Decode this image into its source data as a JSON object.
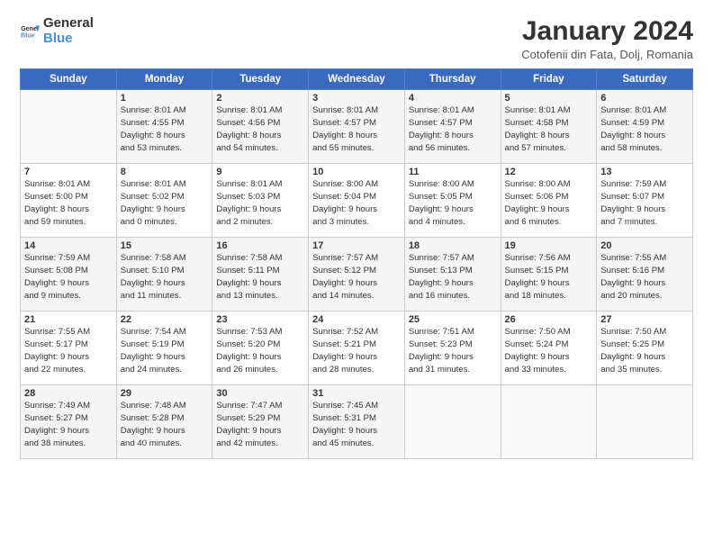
{
  "header": {
    "logo_general": "General",
    "logo_blue": "Blue",
    "title": "January 2024",
    "location": "Cotofenii din Fata, Dolj, Romania"
  },
  "days_of_week": [
    "Sunday",
    "Monday",
    "Tuesday",
    "Wednesday",
    "Thursday",
    "Friday",
    "Saturday"
  ],
  "weeks": [
    [
      {
        "day": "",
        "info": ""
      },
      {
        "day": "1",
        "info": "Sunrise: 8:01 AM\nSunset: 4:55 PM\nDaylight: 8 hours\nand 53 minutes."
      },
      {
        "day": "2",
        "info": "Sunrise: 8:01 AM\nSunset: 4:56 PM\nDaylight: 8 hours\nand 54 minutes."
      },
      {
        "day": "3",
        "info": "Sunrise: 8:01 AM\nSunset: 4:57 PM\nDaylight: 8 hours\nand 55 minutes."
      },
      {
        "day": "4",
        "info": "Sunrise: 8:01 AM\nSunset: 4:57 PM\nDaylight: 8 hours\nand 56 minutes."
      },
      {
        "day": "5",
        "info": "Sunrise: 8:01 AM\nSunset: 4:58 PM\nDaylight: 8 hours\nand 57 minutes."
      },
      {
        "day": "6",
        "info": "Sunrise: 8:01 AM\nSunset: 4:59 PM\nDaylight: 8 hours\nand 58 minutes."
      }
    ],
    [
      {
        "day": "7",
        "info": "Sunrise: 8:01 AM\nSunset: 5:00 PM\nDaylight: 8 hours\nand 59 minutes."
      },
      {
        "day": "8",
        "info": "Sunrise: 8:01 AM\nSunset: 5:02 PM\nDaylight: 9 hours\nand 0 minutes."
      },
      {
        "day": "9",
        "info": "Sunrise: 8:01 AM\nSunset: 5:03 PM\nDaylight: 9 hours\nand 2 minutes."
      },
      {
        "day": "10",
        "info": "Sunrise: 8:00 AM\nSunset: 5:04 PM\nDaylight: 9 hours\nand 3 minutes."
      },
      {
        "day": "11",
        "info": "Sunrise: 8:00 AM\nSunset: 5:05 PM\nDaylight: 9 hours\nand 4 minutes."
      },
      {
        "day": "12",
        "info": "Sunrise: 8:00 AM\nSunset: 5:06 PM\nDaylight: 9 hours\nand 6 minutes."
      },
      {
        "day": "13",
        "info": "Sunrise: 7:59 AM\nSunset: 5:07 PM\nDaylight: 9 hours\nand 7 minutes."
      }
    ],
    [
      {
        "day": "14",
        "info": "Sunrise: 7:59 AM\nSunset: 5:08 PM\nDaylight: 9 hours\nand 9 minutes."
      },
      {
        "day": "15",
        "info": "Sunrise: 7:58 AM\nSunset: 5:10 PM\nDaylight: 9 hours\nand 11 minutes."
      },
      {
        "day": "16",
        "info": "Sunrise: 7:58 AM\nSunset: 5:11 PM\nDaylight: 9 hours\nand 13 minutes."
      },
      {
        "day": "17",
        "info": "Sunrise: 7:57 AM\nSunset: 5:12 PM\nDaylight: 9 hours\nand 14 minutes."
      },
      {
        "day": "18",
        "info": "Sunrise: 7:57 AM\nSunset: 5:13 PM\nDaylight: 9 hours\nand 16 minutes."
      },
      {
        "day": "19",
        "info": "Sunrise: 7:56 AM\nSunset: 5:15 PM\nDaylight: 9 hours\nand 18 minutes."
      },
      {
        "day": "20",
        "info": "Sunrise: 7:55 AM\nSunset: 5:16 PM\nDaylight: 9 hours\nand 20 minutes."
      }
    ],
    [
      {
        "day": "21",
        "info": "Sunrise: 7:55 AM\nSunset: 5:17 PM\nDaylight: 9 hours\nand 22 minutes."
      },
      {
        "day": "22",
        "info": "Sunrise: 7:54 AM\nSunset: 5:19 PM\nDaylight: 9 hours\nand 24 minutes."
      },
      {
        "day": "23",
        "info": "Sunrise: 7:53 AM\nSunset: 5:20 PM\nDaylight: 9 hours\nand 26 minutes."
      },
      {
        "day": "24",
        "info": "Sunrise: 7:52 AM\nSunset: 5:21 PM\nDaylight: 9 hours\nand 28 minutes."
      },
      {
        "day": "25",
        "info": "Sunrise: 7:51 AM\nSunset: 5:23 PM\nDaylight: 9 hours\nand 31 minutes."
      },
      {
        "day": "26",
        "info": "Sunrise: 7:50 AM\nSunset: 5:24 PM\nDaylight: 9 hours\nand 33 minutes."
      },
      {
        "day": "27",
        "info": "Sunrise: 7:50 AM\nSunset: 5:25 PM\nDaylight: 9 hours\nand 35 minutes."
      }
    ],
    [
      {
        "day": "28",
        "info": "Sunrise: 7:49 AM\nSunset: 5:27 PM\nDaylight: 9 hours\nand 38 minutes."
      },
      {
        "day": "29",
        "info": "Sunrise: 7:48 AM\nSunset: 5:28 PM\nDaylight: 9 hours\nand 40 minutes."
      },
      {
        "day": "30",
        "info": "Sunrise: 7:47 AM\nSunset: 5:29 PM\nDaylight: 9 hours\nand 42 minutes."
      },
      {
        "day": "31",
        "info": "Sunrise: 7:45 AM\nSunset: 5:31 PM\nDaylight: 9 hours\nand 45 minutes."
      },
      {
        "day": "",
        "info": ""
      },
      {
        "day": "",
        "info": ""
      },
      {
        "day": "",
        "info": ""
      }
    ]
  ]
}
